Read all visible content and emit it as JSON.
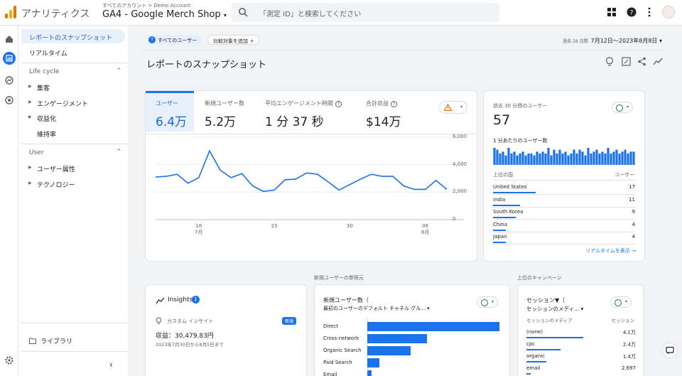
{
  "header": {
    "app_name": "アナリティクス",
    "breadcrumb": "すべてのアカウント > Demo Account",
    "property": "GA4 - Google Merch Shop",
    "search_placeholder": "「測定 ID」と検索してください"
  },
  "sidebar": {
    "items": [
      {
        "label": "レポートのスナップショット"
      },
      {
        "label": "リアルタイム"
      }
    ],
    "lifecycle": {
      "title": "Life cycle",
      "items": [
        {
          "label": "集客"
        },
        {
          "label": "エンゲージメント"
        },
        {
          "label": "収益化"
        },
        {
          "label": "維持率"
        }
      ]
    },
    "user": {
      "title": "User",
      "items": [
        {
          "label": "ユーザー属性"
        },
        {
          "label": "テクノロジー"
        }
      ]
    },
    "library": "ライブラリ"
  },
  "toolbar": {
    "chip_all_users": "すべてのユーザー",
    "chip_compare": "比較対象を追加",
    "date_prefix": "過去 28 日間",
    "date_range": "7月12日～2023年8月8日"
  },
  "page_title": "レポートのスナップショット",
  "metrics": [
    {
      "label": "ユーザー",
      "value": "6.4万"
    },
    {
      "label": "新規ユーザー数",
      "value": "5.2万"
    },
    {
      "label": "平均エンゲージメント時間",
      "value": "1 分 37 秒"
    },
    {
      "label": "合計収益",
      "value": "$14万"
    }
  ],
  "chart_data": {
    "type": "line",
    "x": [
      "7/12",
      "7/13",
      "7/14",
      "7/15",
      "7/16",
      "7/17",
      "7/18",
      "7/19",
      "7/20",
      "7/21",
      "7/22",
      "7/23",
      "7/24",
      "7/25",
      "7/26",
      "7/27",
      "7/28",
      "7/29",
      "7/30",
      "7/31",
      "8/1",
      "8/2",
      "8/3",
      "8/4",
      "8/5",
      "8/6",
      "8/7",
      "8/8"
    ],
    "series": [
      {
        "values": [
          3100,
          3150,
          3300,
          2650,
          3050,
          5000,
          3600,
          3050,
          3350,
          2450,
          2050,
          2150,
          2900,
          2950,
          3400,
          3300,
          2750,
          2150,
          2550,
          2950,
          3300,
          3150,
          3150,
          2450,
          2200,
          2200,
          2850,
          2200
        ]
      }
    ],
    "ylim": [
      0,
      6000
    ],
    "yticks": [
      "6,000",
      "4,000",
      "2,000",
      "0"
    ],
    "xticks": [
      {
        "label": "16",
        "sub": "7月"
      },
      {
        "label": "23",
        "sub": ""
      },
      {
        "label": "30",
        "sub": ""
      },
      {
        "label": "06",
        "sub": "8月"
      }
    ]
  },
  "realtime": {
    "title": "過去 30 分間のユーザー",
    "value": "57",
    "per_minute": "1 分あたりのユーザー数",
    "bars": [
      9,
      8,
      6,
      7,
      5,
      9,
      6,
      7,
      5,
      6,
      7,
      5,
      6,
      6,
      5,
      7,
      6,
      7,
      6,
      9,
      5,
      8,
      6,
      8,
      6,
      7,
      5,
      6,
      8,
      6,
      8,
      7,
      5,
      9,
      6,
      7,
      8,
      6,
      7,
      6,
      9,
      6,
      7,
      8,
      6,
      7,
      8,
      6,
      7,
      7
    ],
    "col_country": "上位の国",
    "col_users": "ユーザー",
    "rows": [
      {
        "name": "United States",
        "value": "17",
        "frac": 0.3
      },
      {
        "name": "India",
        "value": "11",
        "frac": 0.19
      },
      {
        "name": "South Korea",
        "value": "9",
        "frac": 0.16
      },
      {
        "name": "China",
        "value": "4",
        "frac": 0.09
      },
      {
        "name": "Japan",
        "value": "4",
        "frac": 0.09
      }
    ],
    "link": "リアルタイムを表示 →"
  },
  "insights": {
    "title": "Insights",
    "badge": "1",
    "custom": "カスタム インサイト",
    "new_badge": "新規",
    "revenue": "収益：30,479.83円",
    "date_range": "2023年7月30日から8月5日まで"
  },
  "new_users": {
    "section": "新規ユーザーの参照元",
    "title": "新規ユーザー数（",
    "subtitle": "最初のユーザーのデフォルト チャネル グル...",
    "rows": [
      {
        "name": "Direct",
        "frac": 1.0
      },
      {
        "name": "Cross-network",
        "frac": 0.45
      },
      {
        "name": "Organic Search",
        "frac": 0.33
      },
      {
        "name": "Paid Search",
        "frac": 0.09
      },
      {
        "name": "Email",
        "frac": 0.03
      }
    ]
  },
  "campaigns": {
    "section": "上位のキャンペーン",
    "title": "セッション▼（",
    "subtitle": "セッションのメディ...",
    "col1": "セッションのメディア",
    "col2": "セッション",
    "rows": [
      {
        "name": "(none)",
        "value": "4.1万",
        "frac": 0.52
      },
      {
        "name": "cpc",
        "value": "2.4万",
        "frac": 0.31
      },
      {
        "name": "organic",
        "value": "1.4万",
        "frac": 0.18
      },
      {
        "name": "email",
        "value": "2,697",
        "frac": 0.04
      }
    ]
  }
}
